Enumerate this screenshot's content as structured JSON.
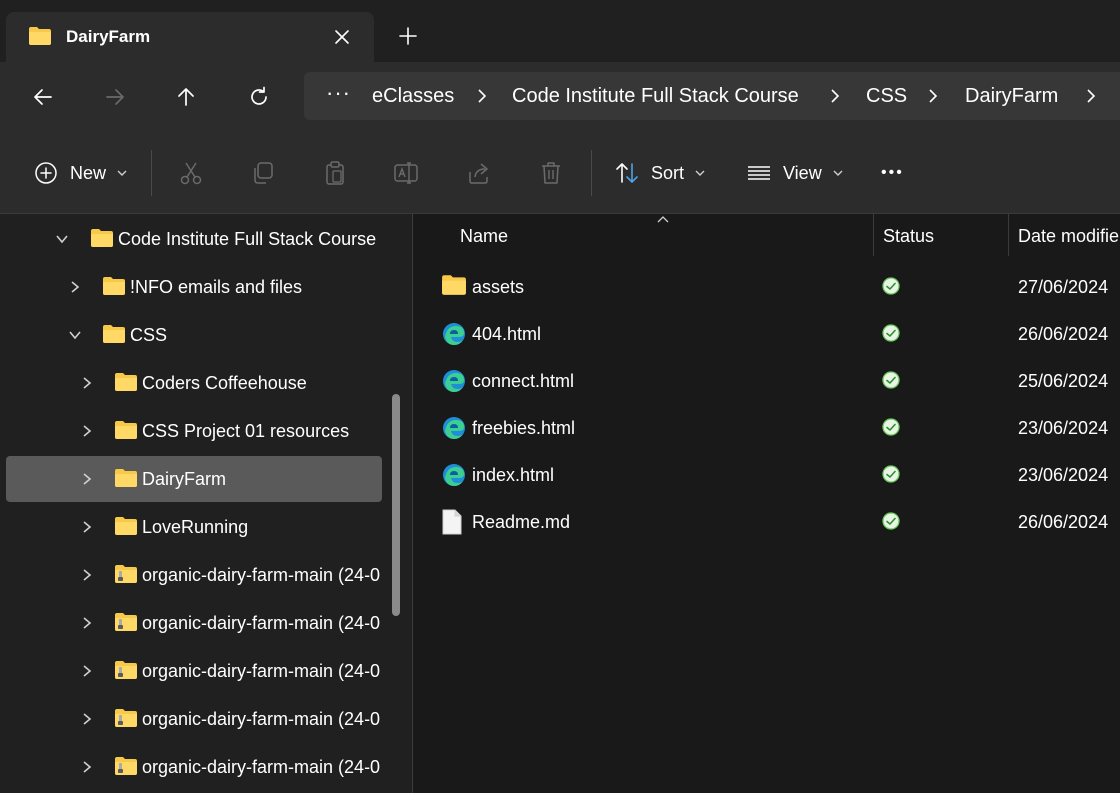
{
  "window": {
    "tab_title": "DairyFarm"
  },
  "breadcrumb": {
    "more": "···",
    "items": [
      "eClasses",
      "Code Institute Full Stack Course",
      "CSS",
      "DairyFarm"
    ]
  },
  "commands": {
    "new_label": "New",
    "sort_label": "Sort",
    "view_label": "View",
    "more": "•••"
  },
  "tree": {
    "items": [
      {
        "label": "Code Institute Full Stack Course",
        "expanded": true,
        "zip": false
      },
      {
        "label": "!NFO emails and files",
        "expanded": false,
        "zip": false
      },
      {
        "label": "CSS",
        "expanded": true,
        "zip": false
      },
      {
        "label": "Coders Coffeehouse",
        "expanded": false,
        "zip": false
      },
      {
        "label": "CSS Project 01 resources",
        "expanded": false,
        "zip": false
      },
      {
        "label": "DairyFarm",
        "expanded": false,
        "zip": false,
        "selected": true
      },
      {
        "label": "LoveRunning",
        "expanded": false,
        "zip": false
      },
      {
        "label": "organic-dairy-farm-main (24-0",
        "expanded": false,
        "zip": true
      },
      {
        "label": "organic-dairy-farm-main (24-0",
        "expanded": false,
        "zip": true
      },
      {
        "label": "organic-dairy-farm-main (24-0",
        "expanded": false,
        "zip": true
      },
      {
        "label": "organic-dairy-farm-main (24-0",
        "expanded": false,
        "zip": true
      },
      {
        "label": "organic-dairy-farm-main (24-0",
        "expanded": false,
        "zip": true
      }
    ]
  },
  "file_list": {
    "columns": {
      "name": "Name",
      "status": "Status",
      "date": "Date modifie"
    },
    "rows": [
      {
        "name": "assets",
        "icon": "folder-icon",
        "date": "27/06/2024"
      },
      {
        "name": "404.html",
        "icon": "edge-icon",
        "date": "26/06/2024"
      },
      {
        "name": "connect.html",
        "icon": "edge-icon",
        "date": "25/06/2024"
      },
      {
        "name": "freebies.html",
        "icon": "edge-icon",
        "date": "23/06/2024"
      },
      {
        "name": "index.html",
        "icon": "edge-icon",
        "date": "23/06/2024"
      },
      {
        "name": "Readme.md",
        "icon": "document-icon",
        "date": "26/06/2024"
      }
    ]
  },
  "colors": {
    "folder": "#f7c948",
    "status_ok": "#6ccb5f",
    "selected": "#5a5a5a"
  }
}
